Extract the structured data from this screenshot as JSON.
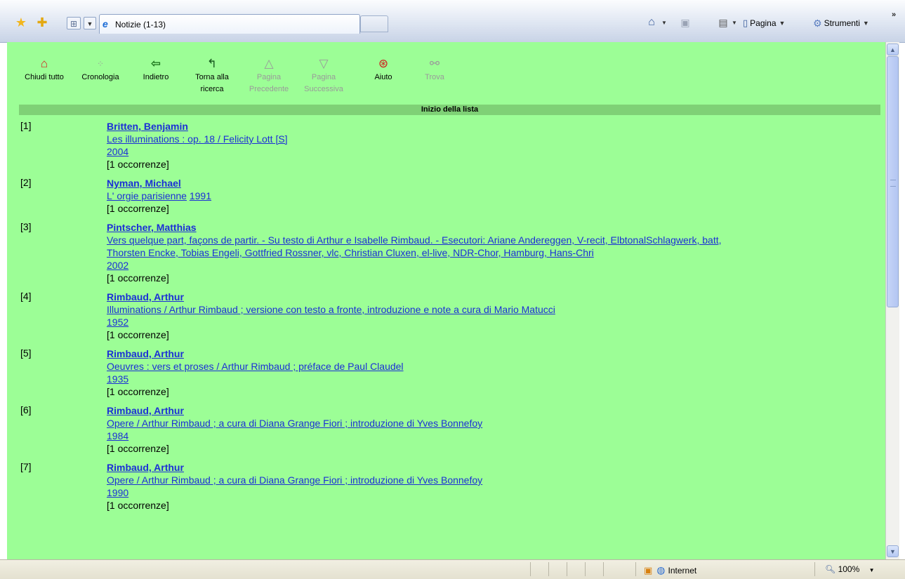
{
  "browser": {
    "tab_title": "Notizie (1-13)",
    "tools": {
      "page_label": "Pagina",
      "tools_label": "Strumenti"
    },
    "icons": [
      "favorites-star-icon",
      "add-favorite-icon",
      "quick-tabs-icon",
      "home-icon",
      "feeds-icon",
      "print-icon",
      "page-icon",
      "tools-gear-icon"
    ]
  },
  "toolbar": {
    "buttons": [
      {
        "label1": "Chiudi tutto",
        "label2": "",
        "icon": "house-icon",
        "enabled": true
      },
      {
        "label1": "Cronologia",
        "label2": "",
        "icon": "history-icon",
        "enabled": true
      },
      {
        "label1": "Indietro",
        "label2": "",
        "icon": "back-arrow-icon",
        "enabled": true
      },
      {
        "label1": "Torna alla",
        "label2": "ricerca",
        "icon": "return-search-icon",
        "enabled": true
      },
      {
        "label1": "Pagina",
        "label2": "Precedente",
        "icon": "triangle-up-icon",
        "enabled": false
      },
      {
        "label1": "Pagina",
        "label2": "Successiva",
        "icon": "triangle-down-icon",
        "enabled": false
      },
      {
        "label1": "Aiuto",
        "label2": "",
        "icon": "lifebuoy-icon",
        "enabled": true
      },
      {
        "label1": "Trova",
        "label2": "",
        "icon": "binoculars-icon",
        "enabled": false
      }
    ]
  },
  "list": {
    "banner": "Inizio della lista",
    "records": [
      {
        "num": "[1]",
        "author": "Britten, Benjamin",
        "title": "Les illuminations : op. 18 / Felicity Lott [S]",
        "title2": "",
        "year": "2004",
        "occ": "[1 occorrenze]"
      },
      {
        "num": "[2]",
        "author": "Nyman, Michael",
        "title": "L' orgie parisienne",
        "title2": "",
        "year": "1991",
        "occ": "[1 occorrenze]"
      },
      {
        "num": "[3]",
        "author": "Pintscher, Matthias",
        "title": "Vers quelque part, façons de partir. - Su testo di Arthur e Isabelle Rimbaud. - Esecutori: Ariane Andereggen, V-recit, ElbtonalSchlagwerk, batt,",
        "title2": "Thorsten Encke, Tobias Engeli, Gottfried Rossner, vlc, Christian Cluxen, el-live, NDR-Chor, Hamburg, Hans-Chri",
        "year": "2002",
        "occ": "[1 occorrenze]"
      },
      {
        "num": "[4]",
        "author": "Rimbaud, Arthur",
        "title": "Illuminations / Arthur Rimbaud ; versione con testo a fronte, introduzione e note a cura di Mario Matucci",
        "title2": "",
        "year": "1952",
        "occ": "[1 occorrenze]"
      },
      {
        "num": "[5]",
        "author": "Rimbaud, Arthur",
        "title": "Oeuvres : vers et proses / Arthur Rimbaud ; préface de Paul Claudel",
        "title2": "",
        "year": "1935",
        "occ": "[1 occorrenze]"
      },
      {
        "num": "[6]",
        "author": "Rimbaud, Arthur",
        "title": "Opere / Arthur Rimbaud ; a cura di Diana Grange Fiori ; introduzione di Yves Bonnefoy",
        "title2": "",
        "year": "1984",
        "occ": "[1 occorrenze]"
      },
      {
        "num": "[7]",
        "author": "Rimbaud, Arthur",
        "title": "Opere / Arthur Rimbaud ; a cura di Diana Grange Fiori ; introduzione di Yves Bonnefoy",
        "title2": "",
        "year": "1990",
        "occ": "[1 occorrenze]"
      }
    ]
  },
  "status": {
    "zone": "Internet",
    "zoom": "100%"
  },
  "colors": {
    "page_bg": "#9cfe96",
    "banner_bg": "#7fd176",
    "link": "#1b2fd6"
  }
}
